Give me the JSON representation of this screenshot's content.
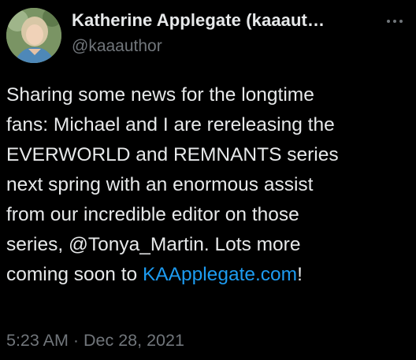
{
  "author": {
    "display_name": "Katherine Applegate (kaaaut…",
    "handle": "@kaaauthor",
    "avatar_icon": "profile-photo"
  },
  "more_icon": "more-horizontal-icon",
  "tweet": {
    "lines": [
      "Sharing some news for the longtime",
      "fans: Michael and I are rereleasing the",
      "EVERWORLD and REMNANTS series",
      "next spring with an enormous assist",
      "from our incredible editor on those",
      "series, @Tonya_Martin. Lots more"
    ],
    "last_line_prefix": "coming soon to ",
    "link_text": "KAApplegate.com",
    "last_line_suffix": "!"
  },
  "timestamp": {
    "time": "5:23 AM",
    "separator": " · ",
    "date": "Dec 28, 2021"
  },
  "colors": {
    "background": "#000000",
    "text": "#e7e9ea",
    "secondary": "#71767b",
    "link": "#1d9bf0"
  }
}
